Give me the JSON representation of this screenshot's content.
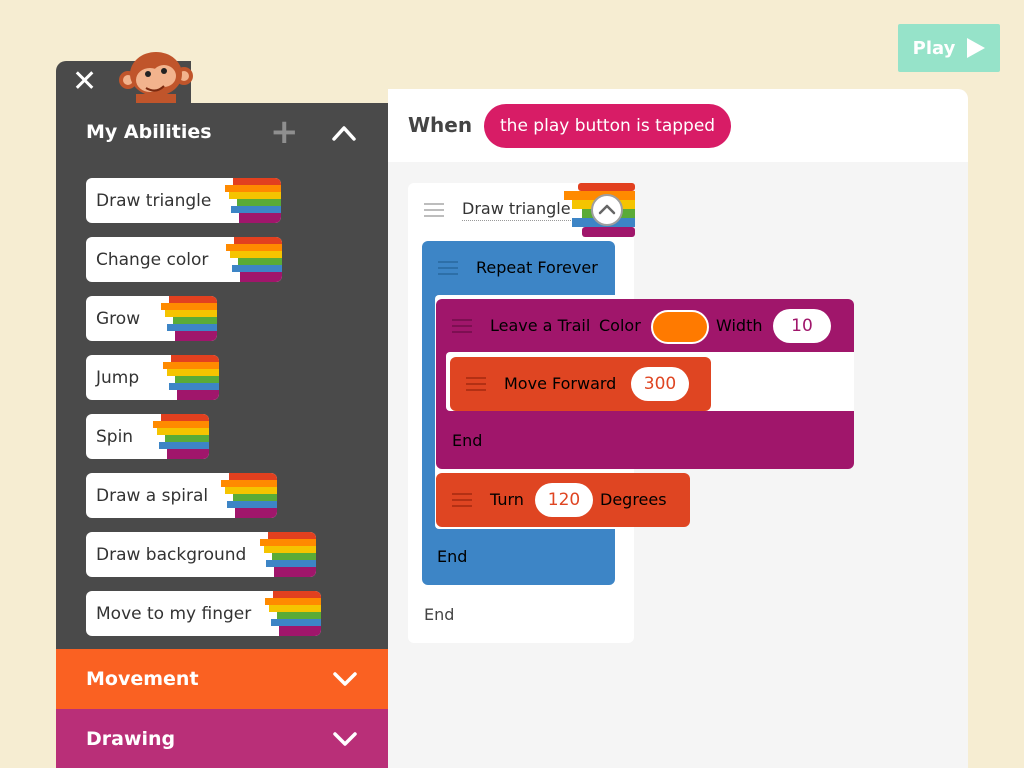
{
  "play_button": {
    "label": "Play"
  },
  "sidebar": {
    "header": "My Abilities",
    "abilities": [
      "Draw triangle",
      "Change color",
      "Grow",
      "Jump",
      "Spin",
      "Draw a spiral",
      "Draw background",
      "Move to my finger"
    ],
    "categories": [
      "Movement",
      "Drawing"
    ]
  },
  "trigger": {
    "when_label": "When",
    "event": "the play button is tapped"
  },
  "script": {
    "ability_name": "Draw triangle",
    "repeat_label": "Repeat Forever",
    "trail_label": "Leave a Trail",
    "trail_color_label": "Color",
    "trail_width_label": "Width",
    "trail_width_value": "10",
    "trail_color": "#ff7a00",
    "move_label": "Move Forward",
    "move_value": "300",
    "trail_end": "End",
    "turn_label": "Turn",
    "turn_value": "120",
    "turn_unit": "Degrees",
    "repeat_end": "End",
    "ability_end": "End"
  },
  "colors": {
    "background": "#f6edd2",
    "sidebar": "#4a4a4a",
    "movement": "#fa6122",
    "drawing": "#b92f78",
    "trigger_pill": "#d81c66",
    "repeat_block": "#3d85c6",
    "trail_block": "#a0166b",
    "move_block": "#df4522",
    "play_button": "#96e3c9"
  },
  "icons": [
    "close-icon",
    "plus-icon",
    "chevron-up-icon",
    "chevron-down-icon",
    "play-icon",
    "drag-handle-icon",
    "collapse-icon",
    "rainbow-icon",
    "monkey-character"
  ]
}
